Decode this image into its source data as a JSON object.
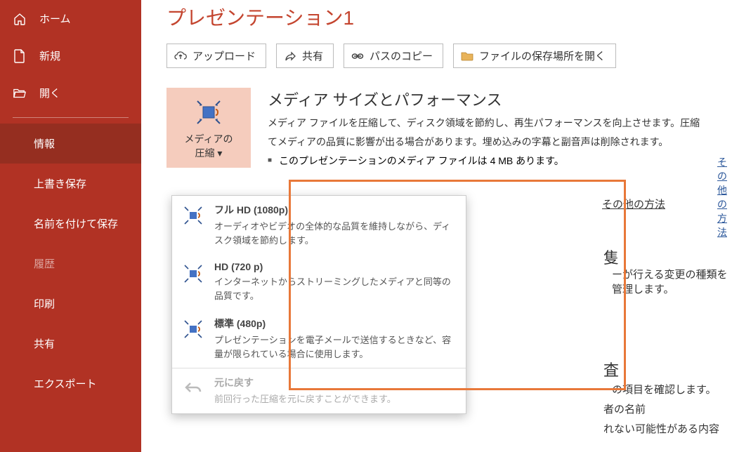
{
  "sidebar": {
    "home": "ホーム",
    "new": "新規",
    "open": "開く",
    "info": "情報",
    "save": "上書き保存",
    "saveas": "名前を付けて保存",
    "history": "履歴",
    "print": "印刷",
    "share": "共有",
    "export": "エクスポート"
  },
  "title": "プレゼンテーション1",
  "actions": {
    "upload": "アップロード",
    "share": "共有",
    "copypath": "パスのコピー",
    "openloc": "ファイルの保存場所を開く"
  },
  "media": {
    "btn_line1": "メディアの",
    "btn_line2": "圧縮 ▾",
    "section_title": "メディア サイズとパフォーマンス",
    "desc": "メディア ファイルを圧縮して、ディスク領域を節約し、再生パフォーマンスを向上させます。圧縮",
    "desc2": "てメディアの品質に影響が出る場合があります。埋め込みの字幕と副音声は削除されます。",
    "bullet1": "このプレゼンテーションのメディア ファイルは 4 MB あります。",
    "link": "その他の方法"
  },
  "frag": {
    "t1": "ーが行える変更の種類を管理します。",
    "t2": "の項目を確認します。",
    "t3": "者の名前",
    "t4": "れない可能性がある内容"
  },
  "popup": {
    "items": [
      {
        "title": "フル HD (1080p)",
        "desc": "オーディオやビデオの全体的な品質を維持しながら、ディスク領域を節約します。"
      },
      {
        "title": "HD (720 p)",
        "desc": "インターネットからストリーミングしたメディアと同等の品質です。"
      },
      {
        "title": "標準 (480p)",
        "desc": "プレゼンテーションを電子メールで送信するときなど、容量が限られている場合に使用します。"
      },
      {
        "title": "元に戻す",
        "desc": "前回行った圧縮を元に戻すことができます。"
      }
    ]
  }
}
